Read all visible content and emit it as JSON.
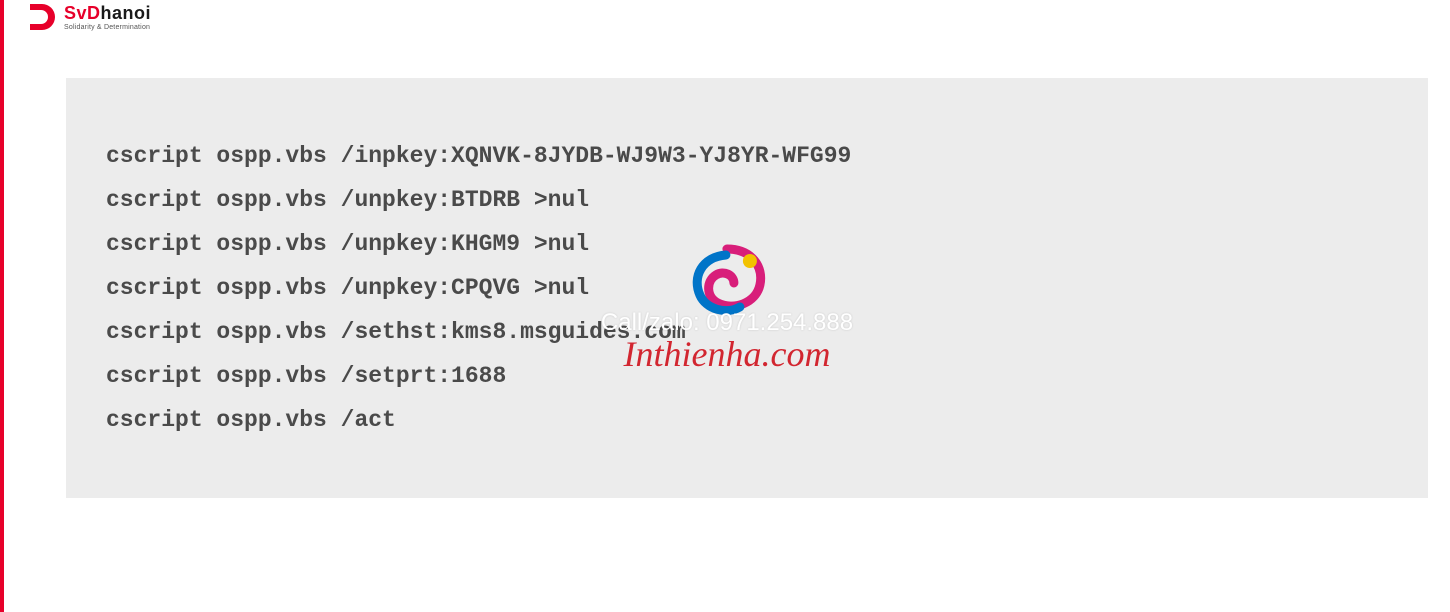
{
  "logo": {
    "brand_prefix": "SvD",
    "brand_suffix": "hanoi",
    "tagline": "Solidarity & Determination"
  },
  "code": {
    "lines": [
      "cscript ospp.vbs /inpkey:XQNVK-8JYDB-WJ9W3-YJ8YR-WFG99",
      "cscript ospp.vbs /unpkey:BTDRB >nul",
      "cscript ospp.vbs /unpkey:KHGM9 >nul",
      "cscript ospp.vbs /unpkey:CPQVG >nul",
      "cscript ospp.vbs /sethst:kms8.msguides.com",
      "cscript ospp.vbs /setprt:1688",
      "cscript ospp.vbs /act"
    ]
  },
  "watermark": {
    "phone_label": "Call/zalo: 0971.254.888",
    "site": "Inthienha.com"
  }
}
